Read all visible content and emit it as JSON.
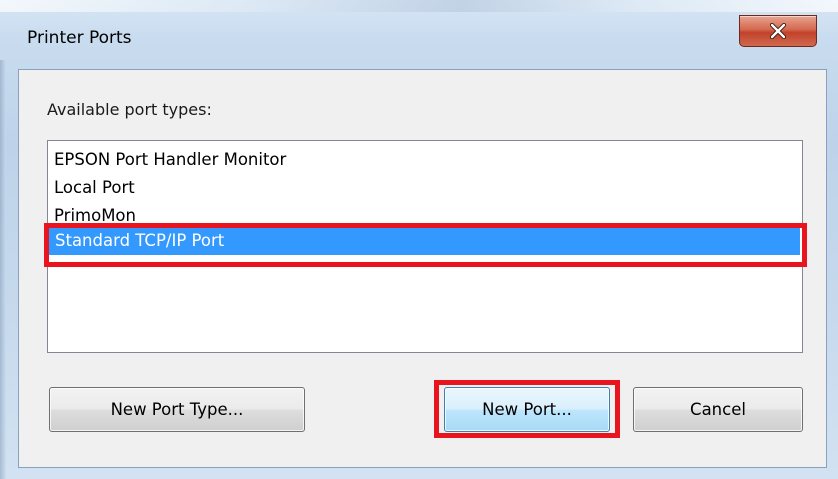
{
  "window": {
    "title": "Printer Ports",
    "close_icon": "close-icon",
    "close_color": "#c9432d"
  },
  "ports": {
    "label": "Available port types:",
    "items": [
      {
        "label": "EPSON Port Handler Monitor",
        "selected": false
      },
      {
        "label": "Local Port",
        "selected": false
      },
      {
        "label": "PrimoMon",
        "selected": false
      },
      {
        "label": "Standard TCP/IP Port",
        "selected": true
      }
    ],
    "selection_color": "#3399ff"
  },
  "buttons": {
    "new_port_type": "New Port Type...",
    "new_port": "New Port...",
    "cancel": "Cancel"
  },
  "highlight_color": "#e8141e"
}
